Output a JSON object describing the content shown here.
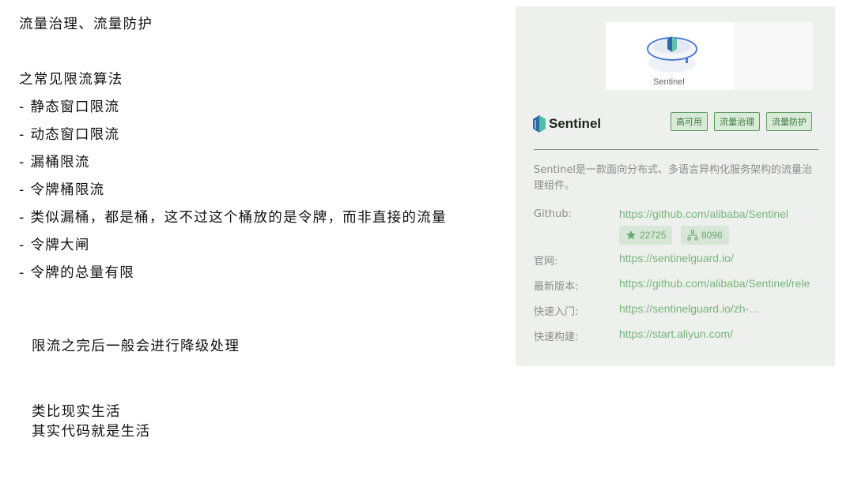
{
  "notes": {
    "lines": [
      "流量治理、流量防护",
      "之常见限流算法",
      "- 静态窗口限流",
      "- 动态窗口限流",
      "- 漏桶限流",
      "- 令牌桶限流",
      "- 类似漏桶，都是桶，这不过这个桶放的是令牌，而非直接的流量",
      "- 令牌大闸",
      "- 令牌的总量有限",
      "限流之完后一般会进行降级处理",
      "类比现实生活",
      "其实代码就是生活"
    ]
  },
  "card": {
    "logo_caption": "Sentinel",
    "brand_name": "Sentinel",
    "tags": [
      "高可用",
      "流量治理",
      "流量防护"
    ],
    "description": "Sentinel是一款面向分布式、多语言异构化服务架构的流量治理组件。",
    "github_label": "Github:",
    "github_url": "https://github.com/alibaba/Sentinel",
    "stars": "22725",
    "forks": "8096",
    "website_label": "官网:",
    "website_url": "https://sentinelguard.io/",
    "latest_label": "最新版本:",
    "latest_url": "https://github.com/alibaba/Sentinel/rele",
    "quickstart_label": "快速入门:",
    "quickstart_url": "https://sentinelguard.io/zh-...",
    "build_label": "快速构建:",
    "build_url": "https://start.aliyun.com/",
    "colors": {
      "accent": "#77b57a",
      "tag_border": "#5b9a5d",
      "panel_bg": "#edf0ed"
    },
    "icons": [
      "sentinel-logo-icon",
      "star-icon",
      "fork-icon"
    ]
  }
}
